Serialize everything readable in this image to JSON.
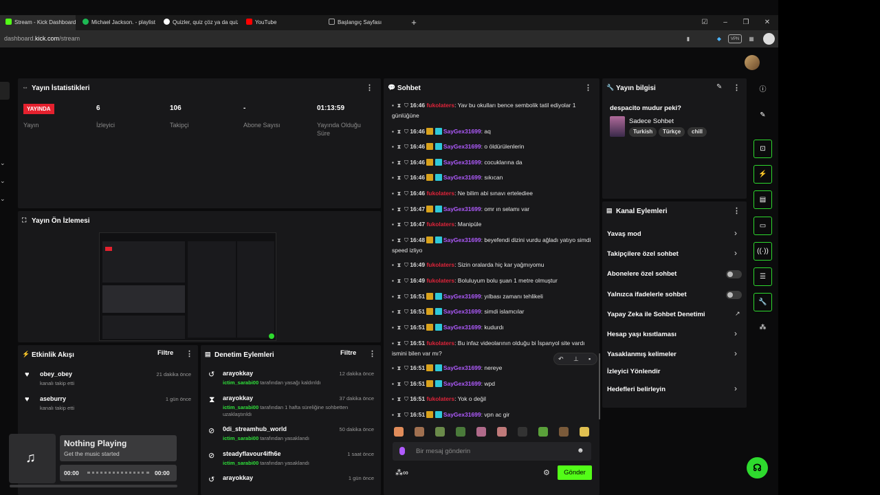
{
  "browser": {
    "tabs": [
      {
        "label": "Stream - Kick Dashboard",
        "color": "#53fc18"
      },
      {
        "label": "Michael Jackson. - playlist b",
        "color": "#1db954"
      },
      {
        "label": "Quizler, quiz çöz ya da quiz",
        "color": "#ffffff"
      },
      {
        "label": "YouTube",
        "color": "#ff0000"
      },
      {
        "label": "Başlangıç Sayfası",
        "color": "#888888"
      }
    ],
    "new_tab_icon": "plus-icon",
    "url_prefix": "dashboard.",
    "url_host": "kick.com",
    "url_path": "/stream",
    "vpn_label": "VPN"
  },
  "stats": {
    "title": "Yayın İstatistikleri",
    "live_badge": "YAYINDA",
    "stream_label": "Yayın",
    "viewers_value": "6",
    "viewers_label": "İzleyici",
    "followers_value": "106",
    "followers_label": "Takipçi",
    "subs_value": "-",
    "subs_label": "Abone Sayısı",
    "duration_value": "01:13:59",
    "duration_label": "Yayında Olduğu Süre"
  },
  "preview": {
    "title": "Yayın Ön İzlemesi"
  },
  "events": {
    "title": "Etkinlik Akışı",
    "filter": "Filtre",
    "items": [
      {
        "user": "obey_obey",
        "action": "kanalı takip etti",
        "time": "21 dakika önce"
      },
      {
        "user": "aseburry",
        "action": "kanalı takip etti",
        "time": "1 gün önce"
      }
    ]
  },
  "music": {
    "title": "Nothing Playing",
    "subtitle": "Get the music started",
    "start": "00:00",
    "end": "00:00",
    "progress": 0
  },
  "moderation": {
    "title": "Denetim Eylemleri",
    "filter": "Filtre",
    "items": [
      {
        "user": "arayokkay",
        "mod": "ictim_sarabi00",
        "action": "tarafından yasağı kaldırıldı",
        "time": "12 dakika önce"
      },
      {
        "user": "arayokkay",
        "mod": "ictim_sarabi00",
        "action": "tarafından 1 hafta süreliğine sohbetten uzaklaştırıldı",
        "time": "37 dakika önce"
      },
      {
        "user": "0di_streamhub_world",
        "mod": "ictim_sarabi00",
        "action": "tarafından yasaklandı",
        "time": "50 dakika önce"
      },
      {
        "user": "steadyflavour4ifh6e",
        "mod": "ictim_sarabi00",
        "action": "tarafından yasaklandı",
        "time": "1 saat önce"
      },
      {
        "user": "arayokkay",
        "mod": "",
        "action": "",
        "time": "1 gün önce"
      }
    ]
  },
  "chat": {
    "title": "Sohbet",
    "messages": [
      {
        "time": "16:46",
        "user": "fukolaters",
        "text": "Yav bu okulları bence sembolik tatil ediyolar 1 günlüğüne",
        "badges": false
      },
      {
        "time": "16:46",
        "user": "SayGex31699",
        "text": "aq",
        "badges": true
      },
      {
        "time": "16:46",
        "user": "SayGex31699",
        "text": "o öldürülenlerin",
        "badges": true
      },
      {
        "time": "16:46",
        "user": "SayGex31699",
        "text": "cocuklarına da",
        "badges": true
      },
      {
        "time": "16:46",
        "user": "SayGex31699",
        "text": "sıkıcan",
        "badges": true
      },
      {
        "time": "16:46",
        "user": "fukolaters",
        "text": "Ne bilim abi sınavı ertelediee",
        "badges": false
      },
      {
        "time": "16:47",
        "user": "SayGex31699",
        "text": "omr ın selamı var",
        "badges": true
      },
      {
        "time": "16:47",
        "user": "fukolaters",
        "text": "Manipüle",
        "badges": false
      },
      {
        "time": "16:48",
        "user": "SayGex31699",
        "text": "beyefendi dizini vurdu ağladı yatıyo simdi speed izliyo",
        "badges": true
      },
      {
        "time": "16:49",
        "user": "fukolaters",
        "text": "Sizin oralarda hiç kar yağmıyomu",
        "badges": false
      },
      {
        "time": "16:49",
        "user": "fukolaters",
        "text": "Boluluyum bolu şuan 1 metre olmuştur",
        "badges": false
      },
      {
        "time": "16:51",
        "user": "SayGex31699",
        "text": "yılbası zamanı tehlikeli",
        "badges": true
      },
      {
        "time": "16:51",
        "user": "SayGex31699",
        "text": "simdi islamcılar",
        "badges": true
      },
      {
        "time": "16:51",
        "user": "SayGex31699",
        "text": "kudurdı",
        "badges": true
      },
      {
        "time": "16:51",
        "user": "fukolaters",
        "text": "Bu infaz videolarının olduğu bi İspanyol site vardı ismini bilen var mı?",
        "badges": false
      },
      {
        "time": "16:51",
        "user": "SayGex31699",
        "text": "nereye",
        "badges": true
      },
      {
        "time": "16:51",
        "user": "SayGex31699",
        "text": "wpd",
        "badges": true
      },
      {
        "time": "16:51",
        "user": "fukolaters",
        "text": "Yok o değil",
        "badges": false
      },
      {
        "time": "16:51",
        "user": "SayGex31699",
        "text": "vpn ac gir",
        "badges": true
      }
    ],
    "input_placeholder": "Bir mesaj gönderin",
    "send_label": "Gönder"
  },
  "info": {
    "title": "Yayın bilgisi",
    "stream_title": "despacito mudur peki?",
    "category": "Sadece Sohbet",
    "tags": [
      "Turkish",
      "Türkçe",
      "chill"
    ]
  },
  "channel_actions": {
    "title": "Kanal Eylemleri",
    "items": [
      {
        "label": "Yavaş mod",
        "control": "chevron"
      },
      {
        "label": "Takipçilere özel sohbet",
        "control": "chevron"
      },
      {
        "label": "Abonelere özel sohbet",
        "control": "toggle"
      },
      {
        "label": "Yalnızca ifadelerle sohbet",
        "control": "toggle"
      },
      {
        "label": "Yapay Zeka ile Sohbet Denetimi",
        "control": "external"
      },
      {
        "label": "Hesap yaşı kısıtlaması",
        "control": "chevron"
      },
      {
        "label": "Yasaklanmış kelimeler",
        "control": "chevron"
      },
      {
        "label": "İzleyici Yönlendir",
        "control": "none"
      },
      {
        "label": "Hedefleri belirleyin",
        "control": "chevron"
      }
    ]
  },
  "colors": {
    "accent": "#53fc18",
    "live": "#e5212e",
    "user_red": "#e0243a",
    "user_purple": "#b05bff"
  }
}
